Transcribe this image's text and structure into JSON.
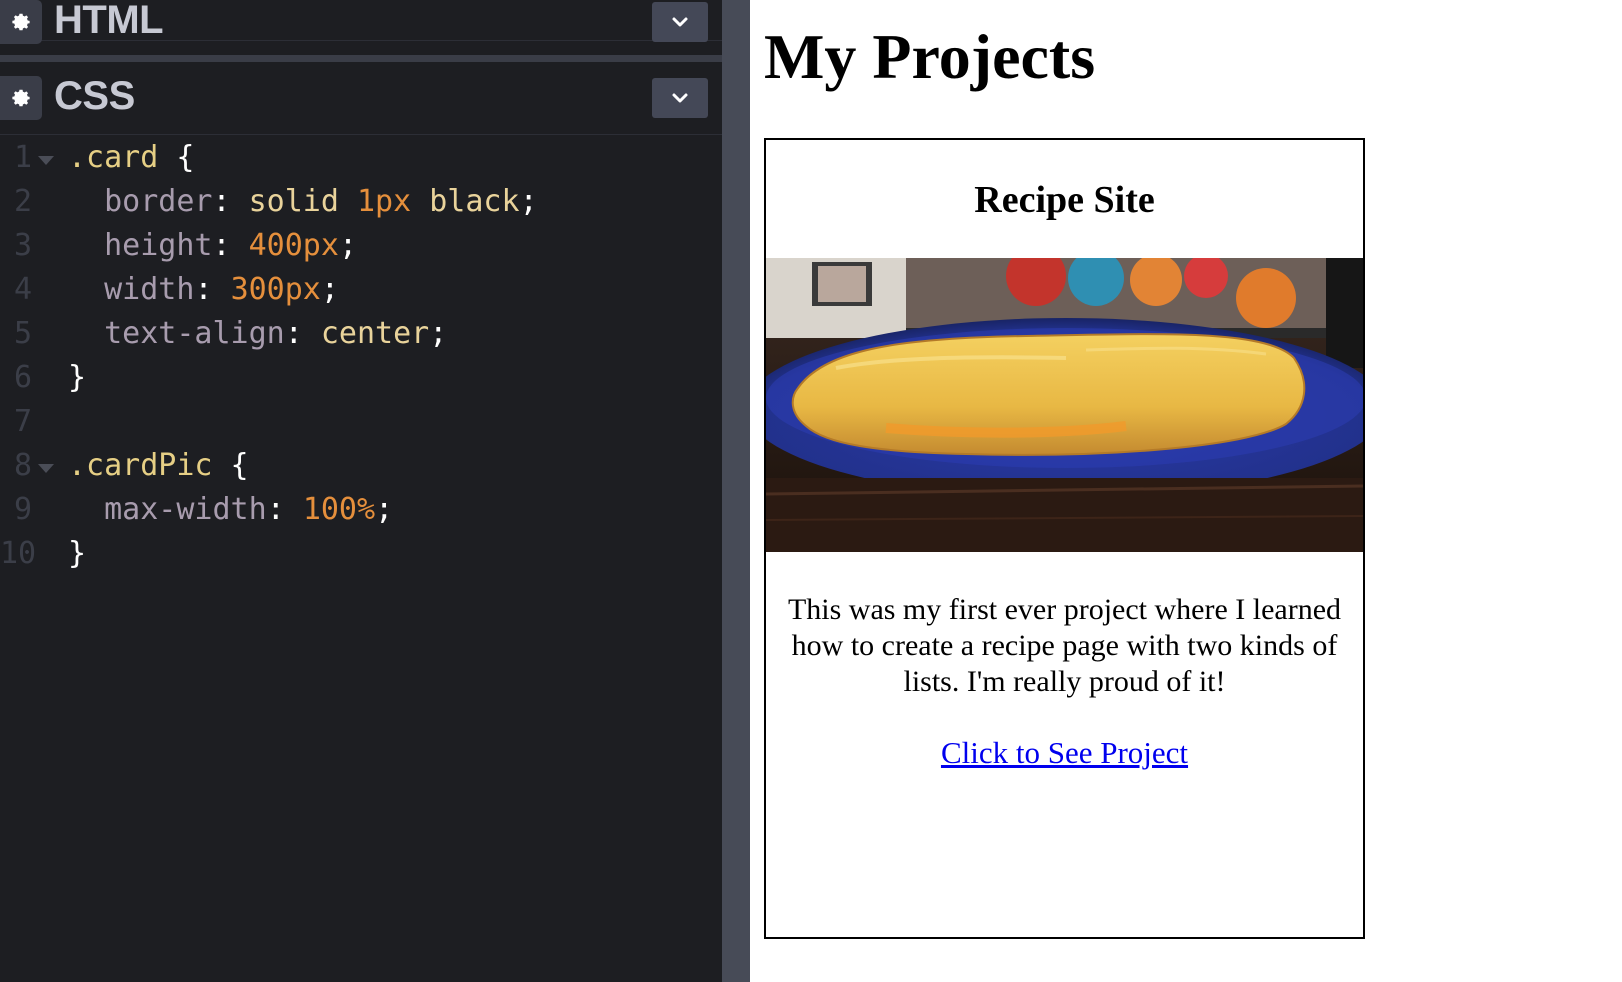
{
  "editor": {
    "html_panel": {
      "title": "HTML",
      "icon": "gear-icon",
      "toggle_icon": "chevron-down-icon"
    },
    "css_panel": {
      "title": "CSS",
      "icon": "gear-icon",
      "toggle_icon": "chevron-down-icon"
    },
    "css_lines": [
      {
        "n": "1",
        "tokens": [
          [
            ".card",
            "sel"
          ],
          [
            " {",
            "pn"
          ]
        ]
      },
      {
        "n": "2",
        "tokens": [
          [
            "  border",
            "prop"
          ],
          [
            ": ",
            "pn"
          ],
          [
            "solid ",
            "val"
          ],
          [
            "1px",
            "num"
          ],
          [
            " black",
            "val"
          ],
          [
            ";",
            "pn"
          ]
        ]
      },
      {
        "n": "3",
        "tokens": [
          [
            "  height",
            "prop"
          ],
          [
            ": ",
            "pn"
          ],
          [
            "400px",
            "num"
          ],
          [
            ";",
            "pn"
          ]
        ]
      },
      {
        "n": "4",
        "tokens": [
          [
            "  width",
            "prop"
          ],
          [
            ": ",
            "pn"
          ],
          [
            "300px",
            "num"
          ],
          [
            ";",
            "pn"
          ]
        ]
      },
      {
        "n": "5",
        "tokens": [
          [
            "  text-align",
            "prop"
          ],
          [
            ": ",
            "pn"
          ],
          [
            "center",
            "val"
          ],
          [
            ";",
            "pn"
          ]
        ]
      },
      {
        "n": "6",
        "tokens": [
          [
            "}",
            "pn"
          ]
        ]
      },
      {
        "n": "7",
        "tokens": []
      },
      {
        "n": "8",
        "tokens": [
          [
            ".cardPic",
            "sel"
          ],
          [
            " {",
            "pn"
          ]
        ]
      },
      {
        "n": "9",
        "tokens": [
          [
            "  max-width",
            "prop"
          ],
          [
            ": ",
            "pn"
          ],
          [
            "100%",
            "num"
          ],
          [
            ";",
            "pn"
          ]
        ]
      },
      {
        "n": "10",
        "tokens": [
          [
            "}",
            "pn"
          ]
        ]
      }
    ]
  },
  "preview": {
    "heading": "My Projects",
    "card": {
      "title": "Recipe Site",
      "image": "omelette-photo",
      "description": "This was my first ever project where I learned how to create a recipe page with two kinds of lists. I'm really proud of it!",
      "link_text": "Click to See Project"
    }
  },
  "colors": {
    "editor_bg": "#1d1e22",
    "selector": "#e6cf85",
    "property": "#a89cae",
    "value": "#e9d39b",
    "number": "#e58f3c",
    "link": "#0000ee"
  }
}
